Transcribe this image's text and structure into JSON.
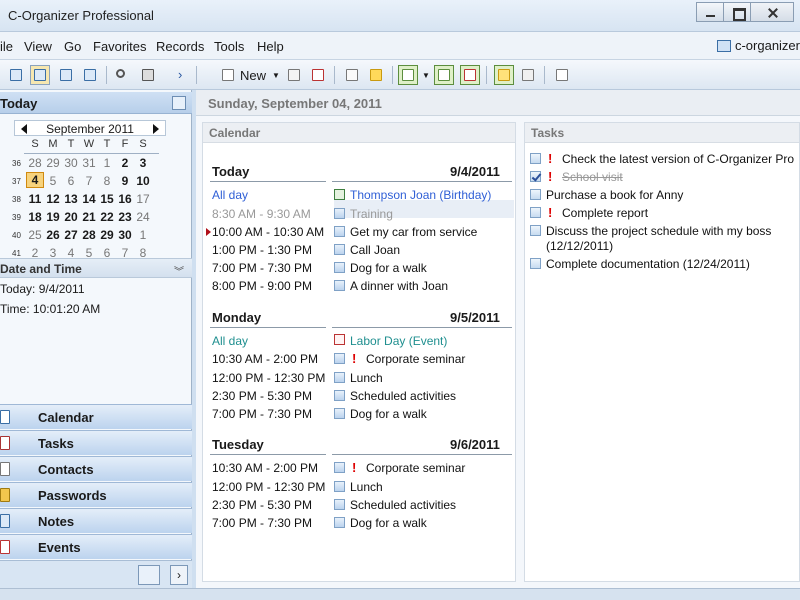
{
  "window": {
    "title": "C-Organizer Professional"
  },
  "menu": {
    "items": [
      "File",
      "View",
      "Go",
      "Favorites",
      "Records",
      "Tools",
      "Help"
    ],
    "brand": "c-organizer"
  },
  "toolbar": {
    "new_label": "New"
  },
  "sidebar": {
    "today_title": "Today",
    "month_label": "September 2011",
    "weekdays": [
      "S",
      "M",
      "T",
      "W",
      "T",
      "F",
      "S"
    ],
    "weeks": [
      {
        "num": "36",
        "days": [
          "28",
          "29",
          "30",
          "31",
          "1",
          "2",
          "3"
        ]
      },
      {
        "num": "37",
        "days": [
          "4",
          "5",
          "6",
          "7",
          "8",
          "9",
          "10"
        ]
      },
      {
        "num": "38",
        "days": [
          "11",
          "12",
          "13",
          "14",
          "15",
          "16",
          "17"
        ]
      },
      {
        "num": "39",
        "days": [
          "18",
          "19",
          "20",
          "21",
          "22",
          "23",
          "24"
        ]
      },
      {
        "num": "40",
        "days": [
          "25",
          "26",
          "27",
          "28",
          "29",
          "30",
          "1"
        ]
      },
      {
        "num": "41",
        "days": [
          "2",
          "3",
          "4",
          "5",
          "6",
          "7",
          "8"
        ]
      }
    ],
    "datetime_title": "Date and Time",
    "today_line": "Today: 9/4/2011",
    "time_line": "Time: 10:01:20 AM",
    "nav": [
      "Calendar",
      "Tasks",
      "Contacts",
      "Passwords",
      "Notes",
      "Events"
    ]
  },
  "main": {
    "date_header": "Sunday, September 04, 2011",
    "calendar_title": "Calendar",
    "tasks_title": "Tasks",
    "days": [
      {
        "label": "Today",
        "date": "9/4/2011",
        "events": [
          {
            "time": "All day",
            "title": "Thompson Joan (Birthday)"
          },
          {
            "time": "8:30 AM - 9:30 AM",
            "title": "Training"
          },
          {
            "time": "10:00 AM - 10:30 AM",
            "title": "Get my car from service"
          },
          {
            "time": "1:00 PM - 1:30 PM",
            "title": "Call Joan"
          },
          {
            "time": "7:00 PM - 7:30 PM",
            "title": "Dog for a walk"
          },
          {
            "time": "8:00 PM - 9:00 PM",
            "title": "A dinner with Joan"
          }
        ]
      },
      {
        "label": "Monday",
        "date": "9/5/2011",
        "events": [
          {
            "time": "All day",
            "title": "Labor Day (Event)"
          },
          {
            "time": "10:30 AM - 2:00 PM",
            "title": "Corporate seminar"
          },
          {
            "time": "12:00 PM - 12:30 PM",
            "title": "Lunch"
          },
          {
            "time": "2:30 PM - 5:30 PM",
            "title": "Scheduled activities"
          },
          {
            "time": "7:00 PM - 7:30 PM",
            "title": "Dog for a walk"
          }
        ]
      },
      {
        "label": "Tuesday",
        "date": "9/6/2011",
        "events": [
          {
            "time": "10:30 AM - 2:00 PM",
            "title": "Corporate seminar"
          },
          {
            "time": "12:00 PM - 12:30 PM",
            "title": "Lunch"
          },
          {
            "time": "2:30 PM - 5:30 PM",
            "title": "Scheduled activities"
          },
          {
            "time": "7:00 PM - 7:30 PM",
            "title": "Dog for a walk"
          }
        ]
      }
    ],
    "tasks": [
      {
        "title": "Check the latest version of C-Organizer Pro"
      },
      {
        "title": "School visit"
      },
      {
        "title": "Purchase a book for Anny"
      },
      {
        "title": "Complete report"
      },
      {
        "title": "Discuss the project schedule with my boss (12/12/2011)"
      },
      {
        "title": "Complete documentation (12/24/2011)"
      }
    ]
  }
}
